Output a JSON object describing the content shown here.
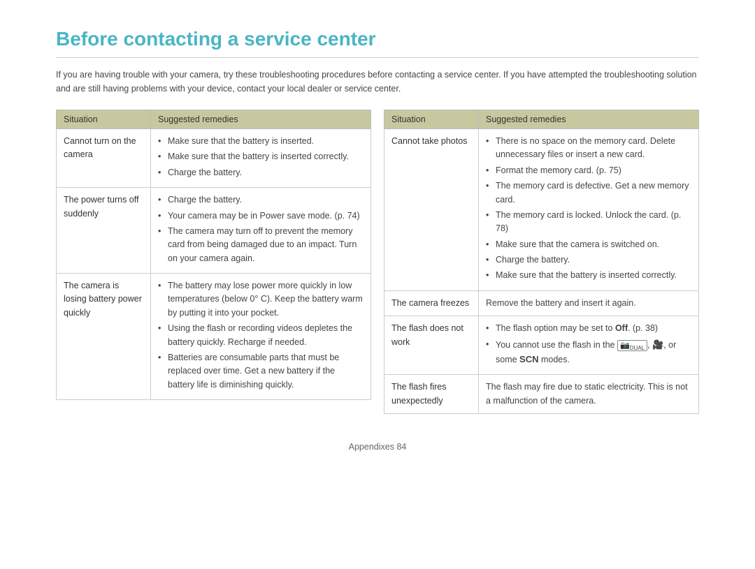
{
  "page": {
    "title": "Before contacting a service center",
    "intro": "If you are having trouble with your camera, try these troubleshooting procedures before contacting a service center. If you have attempted the troubleshooting solution and are still having problems with your device, contact your local dealer or service center.",
    "footer": "Appendixes  84"
  },
  "left_table": {
    "headers": [
      "Situation",
      "Suggested remedies"
    ],
    "rows": [
      {
        "situation": "Cannot turn on the camera",
        "remedies": [
          "Make sure that the battery is inserted.",
          "Make sure that the battery is inserted correctly.",
          "Charge the battery."
        ]
      },
      {
        "situation": "The power turns off suddenly",
        "remedies": [
          "Charge the battery.",
          "Your camera may be in Power save mode. (p. 74)",
          "The camera may turn off to prevent the memory card from being damaged due to an impact. Turn on your camera again."
        ]
      },
      {
        "situation": "The camera is losing battery power quickly",
        "remedies": [
          "The battery may lose power more quickly in low temperatures (below 0° C). Keep the battery warm by putting it into your pocket.",
          "Using the flash or recording videos depletes the battery quickly. Recharge if needed.",
          "Batteries are consumable parts that must be replaced over time. Get a new battery if the battery life is diminishing quickly."
        ]
      }
    ]
  },
  "right_table": {
    "headers": [
      "Situation",
      "Suggested remedies"
    ],
    "rows": [
      {
        "situation": "Cannot take photos",
        "remedies": [
          "There is no space on the memory card. Delete unnecessary files or insert a new card.",
          "Format the memory card. (p. 75)",
          "The memory card is defective. Get a new memory card.",
          "The memory card is locked. Unlock the card. (p. 78)",
          "Make sure that the camera is switched on.",
          "Charge the battery.",
          "Make sure that the battery is inserted correctly."
        ]
      },
      {
        "situation": "The camera freezes",
        "remedies_plain": "Remove the battery and insert it again."
      },
      {
        "situation": "The flash does not work",
        "remedies_mixed": true
      },
      {
        "situation": "The flash fires unexpectedly",
        "remedies_plain": "The flash may fire due to static electricity. This is not a malfunction of the camera."
      }
    ]
  }
}
